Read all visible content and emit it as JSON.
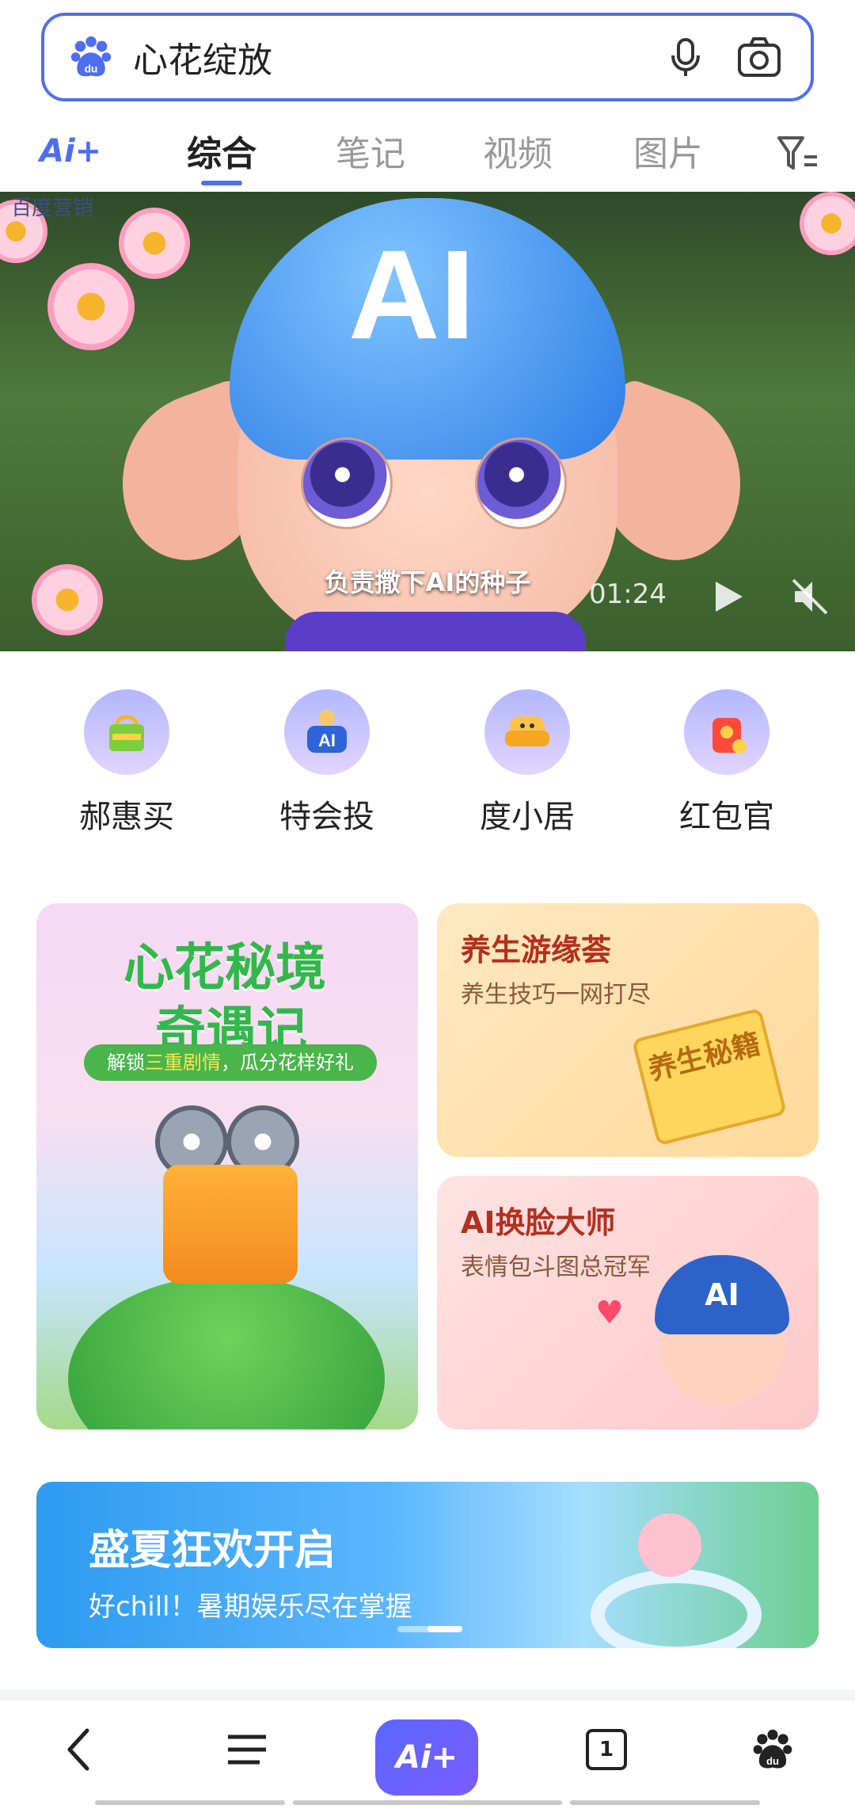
{
  "search": {
    "query": "心花绽放",
    "logo_icon": "baidu-paw-icon",
    "mic_icon": "microphone-icon",
    "camera_icon": "camera-icon"
  },
  "tabs": {
    "ai_label": "Ai+",
    "items": [
      {
        "label": "综合",
        "active": true
      },
      {
        "label": "笔记",
        "active": false
      },
      {
        "label": "视频",
        "active": false
      },
      {
        "label": "图片",
        "active": false
      }
    ],
    "filter_icon": "filter-icon"
  },
  "video": {
    "watermark": "百度营销",
    "helmet_text": "AI",
    "subtitle": "负责撒下AI的种子",
    "duration": "01:24",
    "play_icon": "play-icon",
    "mute_icon": "mute-icon"
  },
  "services": [
    {
      "label": "郝惠买",
      "icon": "shopping-bag-icon"
    },
    {
      "label": "特会投",
      "icon": "ai-robot-icon"
    },
    {
      "label": "度小居",
      "icon": "sofa-icon"
    },
    {
      "label": "红包官",
      "icon": "red-packet-icon"
    }
  ],
  "promo_left": {
    "title_line1": "心花秘境",
    "title_line2": "奇遇记",
    "ribbon_prefix": "解锁",
    "ribbon_highlight": "三重剧情",
    "ribbon_suffix": "，瓜分花样好礼"
  },
  "promo_right": [
    {
      "title": "养生游缘荟",
      "subtitle": "养生技巧一网打尽",
      "badge": "养生秘籍"
    },
    {
      "title": "AI换脸大师",
      "subtitle": "表情包斗图总冠军",
      "badge": "AI"
    }
  ],
  "summer_banner": {
    "title": "盛夏狂欢开启",
    "subtitle": "好chill！暑期娱乐尽在掌握"
  },
  "bottom_nav": {
    "back_icon": "back-chevron-icon",
    "menu_icon": "menu-icon",
    "ai_label": "Ai+",
    "tab_count": "1",
    "home_icon": "baidu-paw-icon"
  },
  "colors": {
    "accent": "#4e6ef2",
    "ai_gradient_start": "#5a67ff",
    "ai_gradient_end": "#7b5cff"
  }
}
